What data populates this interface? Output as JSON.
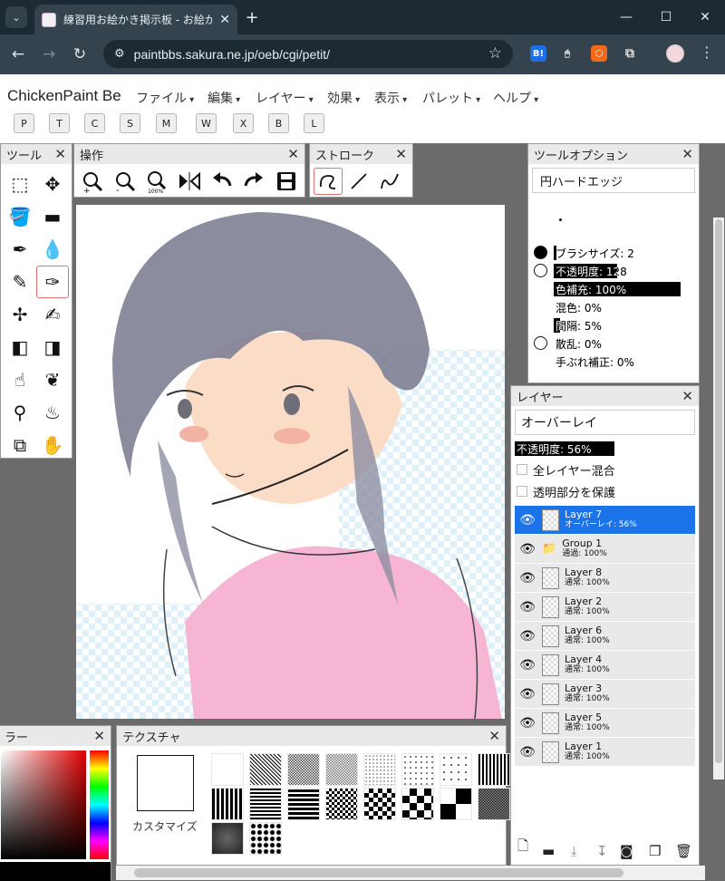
{
  "browser": {
    "tab_title": "練習用お絵かき掲示板 - お絵かき",
    "tab_close": "✕",
    "new_tab": "+",
    "url": "paintbbs.sakura.ne.jp/oeb/cgi/petit/",
    "window_buttons": [
      "—",
      "☐",
      "✕"
    ],
    "extensions": [
      {
        "name": "hatena-bookmark-icon",
        "label": "B!",
        "color": "#1d6fe6"
      },
      {
        "name": "mouse-icon",
        "label": "🖱",
        "color": "#34434e"
      },
      {
        "name": "shield-icon",
        "label": "⬡",
        "color": "#f06a1a"
      },
      {
        "name": "puzzle-icon",
        "label": "⧉",
        "color": "#34434e"
      }
    ]
  },
  "app": {
    "name": "ChickenPaint Be",
    "menus": [
      "ファイル",
      "編集",
      "レイヤー",
      "効果",
      "表示",
      "パレット",
      "ヘルプ"
    ],
    "quick_buttons": [
      "P",
      "T",
      "C",
      "S",
      "M",
      "W",
      "X",
      "B",
      "L"
    ]
  },
  "tools_palette": {
    "title": "ツール",
    "close": "✕",
    "tools": [
      "rect-select-icon",
      "move-icon",
      "flood-fill-icon",
      "gradient-icon",
      "eyedropper-icon",
      "water-drop-icon",
      "pencil-icon",
      "pen-icon",
      "airbrush-icon",
      "watercolor-icon",
      "eraser-icon",
      "soft-eraser-icon",
      "smudge-icon",
      "blender-icon",
      "dodge-icon",
      "burn-icon",
      "transform-icon",
      "hand-icon"
    ],
    "selected": "pen-icon"
  },
  "ops_palette": {
    "title": "操作",
    "close": "✕",
    "buttons": [
      "zoom-in-icon",
      "zoom-out-icon",
      "zoom-100-icon",
      "flip-horizontal-icon",
      "undo-icon",
      "redo-icon",
      "save-icon"
    ]
  },
  "stroke_palette": {
    "title": "ストローク",
    "close": "✕",
    "buttons": [
      "freehand-curve-icon",
      "straight-line-icon",
      "bezier-curve-icon"
    ]
  },
  "tool_options": {
    "title": "ツールオプション",
    "close": "✕",
    "brush": "円ハードエッジ",
    "sliders": [
      {
        "label": "ブラシサイズ: 2",
        "fill": 0.02,
        "radio": "on"
      },
      {
        "label": "不透明度: 128",
        "fill": 0.5,
        "radio": "off"
      },
      {
        "label": "色補充: 100%",
        "fill": 1.0
      },
      {
        "label": "混色: 0%",
        "fill": 0.0
      },
      {
        "label": "間隔: 5%",
        "fill": 0.05
      },
      {
        "label": "散乱: 0%",
        "fill": 0.0,
        "radio": "off"
      },
      {
        "label": "手ぶれ補正: 0%",
        "fill": 0.0
      }
    ]
  },
  "layers_palette": {
    "title": "レイヤー",
    "close": "✕",
    "blend_mode": "オーバーレイ",
    "opacity_label": "不透明度: 56%",
    "opacity": 0.56,
    "checkboxes": [
      "全レイヤー混合",
      "透明部分を保護"
    ],
    "layers": [
      {
        "name": "Layer 7",
        "mode": "オーバーレイ: 56%",
        "active": true
      },
      {
        "name": "Group 1",
        "mode": "通過: 100%",
        "group": true
      },
      {
        "name": "Layer 8",
        "mode": "通常: 100%"
      },
      {
        "name": "Layer 2",
        "mode": "通常: 100%"
      },
      {
        "name": "Layer 6",
        "mode": "通常: 100%"
      },
      {
        "name": "Layer 4",
        "mode": "通常: 100%"
      },
      {
        "name": "Layer 3",
        "mode": "通常: 100%"
      },
      {
        "name": "Layer 5",
        "mode": "通常: 100%"
      },
      {
        "name": "Layer 1",
        "mode": "通常: 100%"
      }
    ],
    "footer_buttons": [
      "new-layer-icon",
      "new-group-icon",
      "merge-down-icon",
      "merge-visible-icon",
      "mask-icon",
      "duplicate-icon",
      "delete-icon"
    ]
  },
  "color_palette": {
    "title": "ラー",
    "close": "✕"
  },
  "texture_palette": {
    "title": "テクスチャ",
    "close": "✕",
    "custom_label": "カスタマイズ"
  }
}
